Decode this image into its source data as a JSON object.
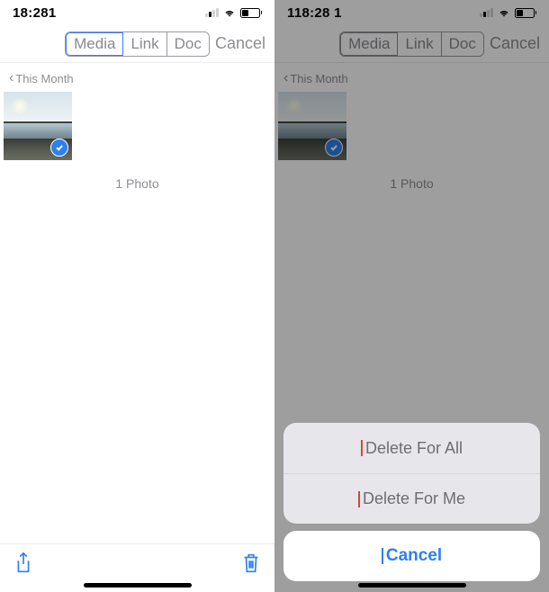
{
  "left": {
    "status": {
      "time": "18:281"
    },
    "tabs": {
      "media": "Media",
      "link": "Link",
      "doc": "Doc"
    },
    "cancel": "Cancel",
    "section": "This Month",
    "count": "1 Photo"
  },
  "right": {
    "status": {
      "time": "118:28 1"
    },
    "tabs": {
      "media": "Media",
      "link": "Link",
      "doc": "Doc"
    },
    "cancel": "Cancel",
    "section": "This Month",
    "count": "1 Photo",
    "sheet": {
      "delete_all": "Delete For All",
      "delete_me": "Delete For Me",
      "cancel": "Cancel"
    }
  }
}
